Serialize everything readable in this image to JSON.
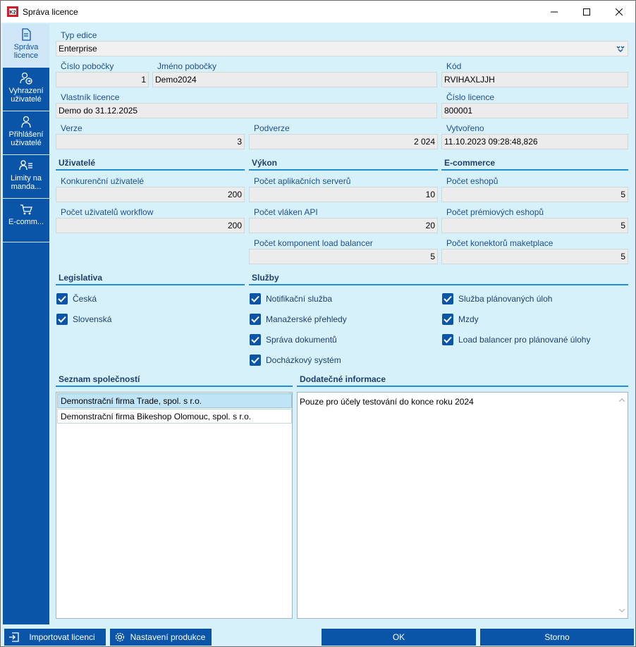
{
  "window": {
    "title": "Správa licence"
  },
  "sidebar": {
    "items": [
      {
        "label": "Správa licence",
        "icon": "license-document-icon"
      },
      {
        "label": "Vyhrazení uživatelé",
        "icon": "user-arrow-icon"
      },
      {
        "label": "Přihlášení uživatelé",
        "icon": "user-icon"
      },
      {
        "label": "Limity na manda...",
        "icon": "user-list-icon"
      },
      {
        "label": "E-comm...",
        "icon": "cart-icon"
      }
    ]
  },
  "form": {
    "typ_edice": {
      "label": "Typ edice",
      "value": "Enterprise"
    },
    "cislo_pobocky": {
      "label": "Číslo pobočky",
      "value": "1"
    },
    "jmeno_pobocky": {
      "label": "Jméno pobočky",
      "value": "Demo2024"
    },
    "kod": {
      "label": "Kód",
      "value": "RVIHAXLJJH"
    },
    "vlastnik": {
      "label": "Vlastník licence",
      "value": "Demo do 31.12.2025"
    },
    "cislo_licence": {
      "label": "Číslo licence",
      "value": "800001"
    },
    "verze": {
      "label": "Verze",
      "value": "3"
    },
    "podverze": {
      "label": "Podverze",
      "value": "2 024"
    },
    "vytvoreno": {
      "label": "Vytvořeno",
      "value": "11.10.2023 09:28:48,826"
    }
  },
  "sections": {
    "uzivatele": {
      "title": "Uživatelé",
      "konkurencni": {
        "label": "Konkurenční uživatelé",
        "value": "200"
      },
      "workflow": {
        "label": "Počet uživatelů workflow",
        "value": "200"
      }
    },
    "vykon": {
      "title": "Výkon",
      "servery": {
        "label": "Počet aplikačních serverů",
        "value": "10"
      },
      "vlakna": {
        "label": "Počet vláken API",
        "value": "20"
      },
      "load": {
        "label": "Počet komponent load balancer",
        "value": "5"
      }
    },
    "ecommerce": {
      "title": "E-commerce",
      "eshopy": {
        "label": "Počet eshopů",
        "value": "5"
      },
      "premiove": {
        "label": "Počet prémiových eshopů",
        "value": "5"
      },
      "konektory": {
        "label": "Počet konektorů maketplace",
        "value": "5"
      }
    },
    "legislativa": {
      "title": "Legislativa",
      "items": [
        {
          "label": "Česká",
          "checked": true
        },
        {
          "label": "Slovenská",
          "checked": true
        }
      ]
    },
    "sluzby": {
      "title": "Služby",
      "items": [
        {
          "label": "Notifikační služba",
          "checked": true
        },
        {
          "label": "Manažerské přehledy",
          "checked": true
        },
        {
          "label": "Správa dokumentů",
          "checked": true
        },
        {
          "label": "Docházkový systém",
          "checked": true
        },
        {
          "label": "Služba plánovaných úloh",
          "checked": true
        },
        {
          "label": "Mzdy",
          "checked": true
        },
        {
          "label": "Load balancer pro plánované úlohy",
          "checked": true
        }
      ]
    },
    "spolecnosti": {
      "title": "Seznam společností",
      "rows": [
        "Demonstrační firma Trade, spol. s r.o.",
        "Demonstrační firma Bikeshop Olomouc, spol. s r.o."
      ]
    },
    "dodatecne": {
      "title": "Dodatečné informace",
      "text": "Pouze pro účely testování do konce roku 2024"
    }
  },
  "buttons": {
    "import": "Importovat licenci",
    "settings": "Nastavení produkce",
    "ok": "OK",
    "cancel": "Storno"
  },
  "colors": {
    "accent": "#0a55a8",
    "background": "#d7f1fb",
    "section_line": "#1f8fd0"
  }
}
